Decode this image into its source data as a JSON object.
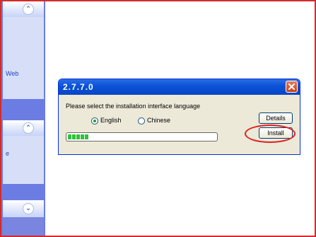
{
  "window": {
    "title": "2.7.7.0",
    "close_icon": "close-icon"
  },
  "dialog": {
    "prompt": "Please select the installation interface language",
    "language_options": [
      {
        "label": "English",
        "selected": true
      },
      {
        "label": "Chinese",
        "selected": false
      }
    ],
    "details_label": "Details",
    "install_label": "Install",
    "progress_blocks": 5
  },
  "taskpane": {
    "link_1": "Web",
    "link_2": "e",
    "section_icons": [
      "chevron-up-icon",
      "chevron-up-icon",
      "chevron-down-icon"
    ]
  },
  "colors": {
    "frame_red": "#d42a2a",
    "titlebar_blue": "#0a52d8",
    "dialog_bg": "#ece9d8",
    "progress_green": "#2ec13a",
    "highlight_red": "#e02020"
  }
}
